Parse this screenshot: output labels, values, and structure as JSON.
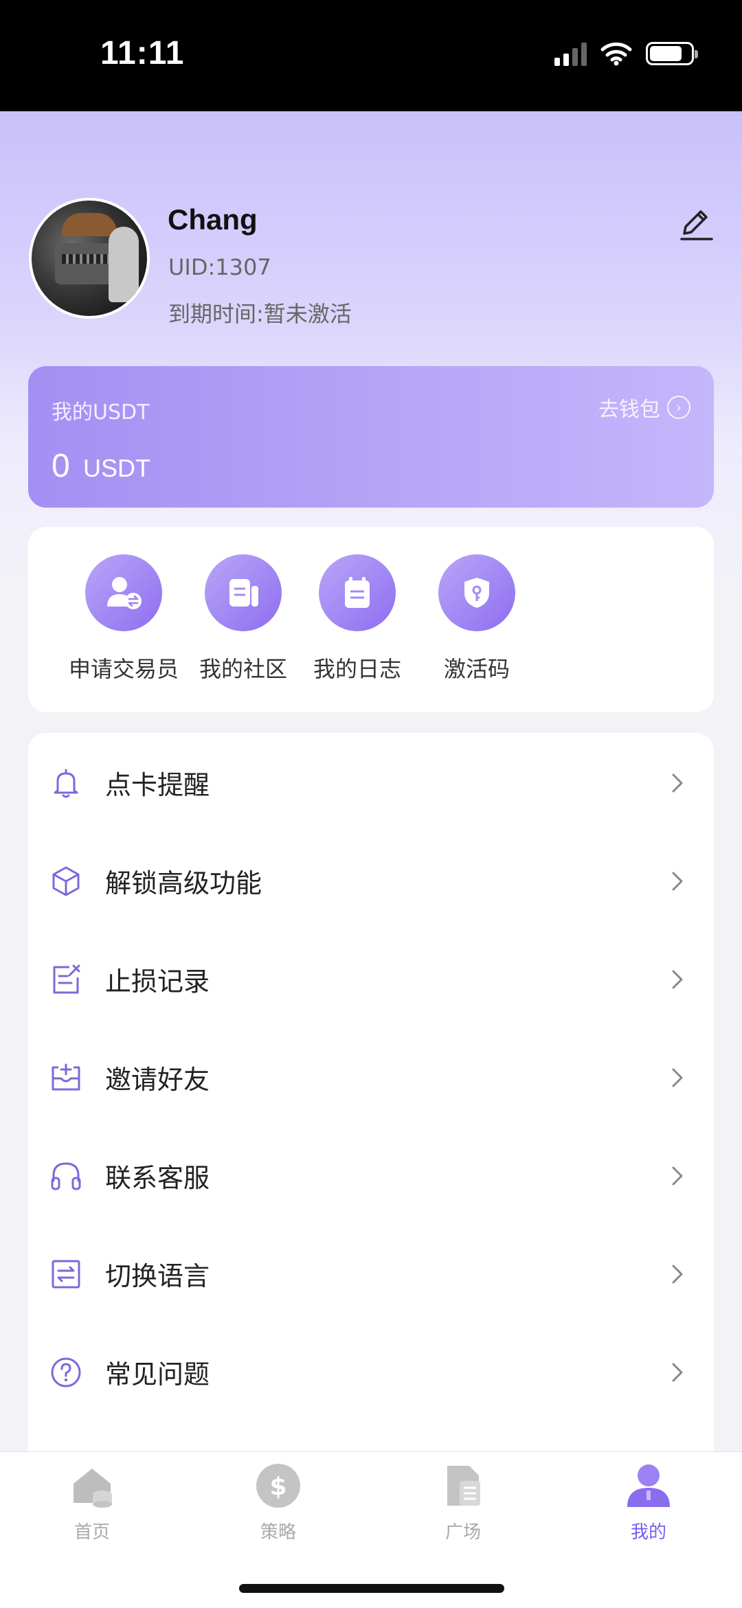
{
  "status_bar": {
    "time": "11:11"
  },
  "profile": {
    "name": "Chang",
    "uid": "UID:1307",
    "expiry": "到期时间:暂未激活",
    "avatar_icon": "avatar-photo",
    "edit_icon": "edit-icon"
  },
  "wallet": {
    "title": "我的USDT",
    "link_label": "去钱包",
    "amount": "0",
    "unit": "USDT"
  },
  "shortcuts": [
    {
      "label": "申请交易员",
      "icon": "trader-apply-icon"
    },
    {
      "label": "我的社区",
      "icon": "community-icon"
    },
    {
      "label": "我的日志",
      "icon": "journal-icon"
    },
    {
      "label": "激活码",
      "icon": "activation-code-icon"
    }
  ],
  "menu": [
    {
      "label": "点卡提醒",
      "icon": "bell-icon"
    },
    {
      "label": "解锁高级功能",
      "icon": "cube-icon"
    },
    {
      "label": "止损记录",
      "icon": "note-icon"
    },
    {
      "label": "邀请好友",
      "icon": "invite-inbox-icon"
    },
    {
      "label": "联系客服",
      "icon": "headset-icon"
    },
    {
      "label": "切换语言",
      "icon": "switch-language-icon"
    },
    {
      "label": "常见问题",
      "icon": "question-icon"
    }
  ],
  "tabbar": [
    {
      "label": "首页",
      "icon": "home-icon",
      "active": false
    },
    {
      "label": "策略",
      "icon": "dollar-icon",
      "active": false
    },
    {
      "label": "广场",
      "icon": "document-icon",
      "active": false
    },
    {
      "label": "我的",
      "icon": "user-icon",
      "active": true
    }
  ],
  "colors": {
    "accent": "#7a5cf0",
    "inactive": "#aaaaaa",
    "icon_line": "#7d68d8"
  }
}
